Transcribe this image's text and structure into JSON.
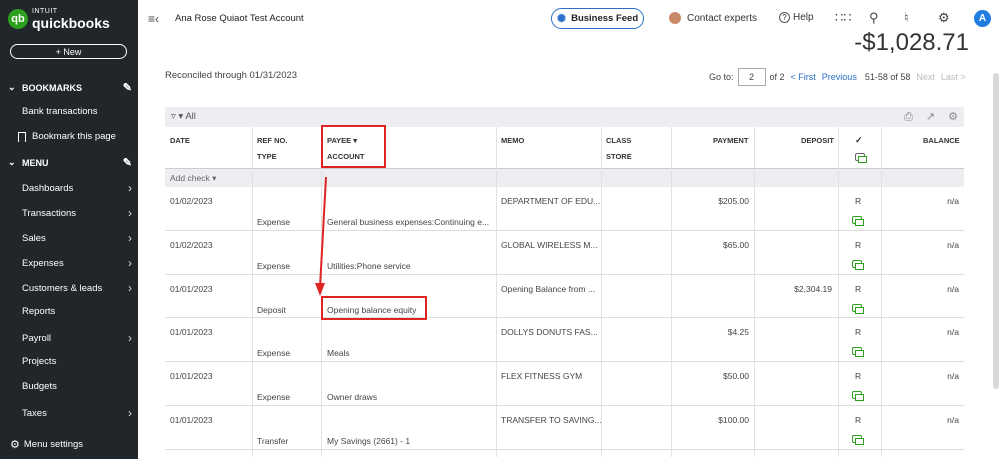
{
  "brand": {
    "intuit": "INTUIT",
    "quickbooks": "quickbooks",
    "badge": "qb"
  },
  "sidebar": {
    "new_label": "+ New",
    "bookmarks_label": "BOOKMARKS",
    "bookmarks_items": [
      "Bank transactions",
      "Bookmark this page"
    ],
    "menu_label": "MENU",
    "menu_items": [
      {
        "label": "Dashboards",
        "arrow": true
      },
      {
        "label": "Transactions",
        "arrow": true
      },
      {
        "label": "Sales",
        "arrow": true
      },
      {
        "label": "Expenses",
        "arrow": true
      },
      {
        "label": "Customers & leads",
        "arrow": true
      },
      {
        "label": "Reports",
        "arrow": false
      },
      {
        "label": "Payroll",
        "arrow": true
      },
      {
        "label": "Projects",
        "arrow": false
      },
      {
        "label": "Budgets",
        "arrow": false
      },
      {
        "label": "Taxes",
        "arrow": true
      }
    ],
    "menu_settings": "Menu settings"
  },
  "topbar": {
    "account_name": "Ana Rose Quiaot Test Account",
    "business_feed": "Business Feed",
    "contact_experts": "Contact experts",
    "help": "Help",
    "avatar_letter": "A"
  },
  "main": {
    "balance": "-$1,028.71",
    "reconciled": "Reconciled through 01/31/2023",
    "pager": {
      "goto_label": "Go to:",
      "page": "2",
      "of_label": "of 2",
      "first": "< First",
      "previous": "Previous",
      "range": "51-58 of 58",
      "next": "Next",
      "last": "Last >"
    },
    "filter_label": "All",
    "add_check": "Add check"
  },
  "columns": {
    "date": "DATE",
    "ref": "REF NO.",
    "type": "TYPE",
    "payee": "PAYEE",
    "account": "ACCOUNT",
    "memo": "MEMO",
    "class": "CLASS",
    "store": "STORE",
    "payment": "PAYMENT",
    "deposit": "DEPOSIT",
    "check": "✓",
    "balance": "BALANCE"
  },
  "rows": [
    {
      "date": "01/02/2023",
      "type": "Expense",
      "account": "General business expenses:Continuing e...",
      "memo": "DEPARTMENT OF EDU...",
      "payment": "$205.00",
      "deposit": "",
      "status": "R",
      "balance": "n/a"
    },
    {
      "date": "01/02/2023",
      "type": "Expense",
      "account": "Utilities:Phone service",
      "memo": "GLOBAL WIRELESS M...",
      "payment": "$65.00",
      "deposit": "",
      "status": "R",
      "balance": "n/a"
    },
    {
      "date": "01/01/2023",
      "type": "Deposit",
      "account": "Opening balance equity",
      "memo": "Opening Balance from ...",
      "payment": "",
      "deposit": "$2,304.19",
      "status": "R",
      "balance": "n/a"
    },
    {
      "date": "01/01/2023",
      "type": "Expense",
      "account": "Meals",
      "memo": "DOLLYS DONUTS FAS...",
      "payment": "$4.25",
      "deposit": "",
      "status": "R",
      "balance": "n/a"
    },
    {
      "date": "01/01/2023",
      "type": "Expense",
      "account": "Owner draws",
      "memo": "FLEX FITNESS GYM",
      "payment": "$50.00",
      "deposit": "",
      "status": "R",
      "balance": "n/a"
    },
    {
      "date": "01/01/2023",
      "type": "Transfer",
      "account": "My Savings (2661) - 1",
      "memo": "TRANSFER TO SAVING...",
      "payment": "$100.00",
      "deposit": "",
      "status": "R",
      "balance": "n/a"
    }
  ],
  "colors": {
    "brand_green": "#2ca01c",
    "link_blue": "#2a6fc9",
    "highlight_red": "#e02424",
    "sidebar_bg": "#21262b"
  }
}
